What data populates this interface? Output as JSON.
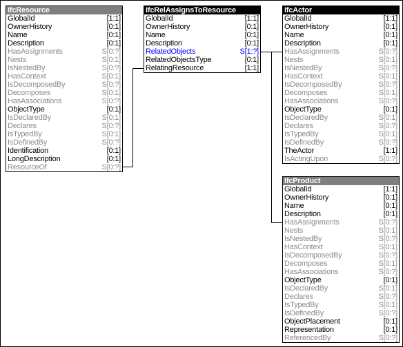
{
  "diagram": {
    "entities": [
      {
        "id": "ifc-resource",
        "name": "IfcResource",
        "header_style": "grey",
        "attributes": [
          {
            "name": "GlobalId",
            "card": "[1:1]",
            "kind": "explicit"
          },
          {
            "name": "OwnerHistory",
            "card": "[0:1]",
            "kind": "explicit"
          },
          {
            "name": "Name",
            "card": "[0:1]",
            "kind": "explicit"
          },
          {
            "name": "Description",
            "card": "[0:1]",
            "kind": "explicit"
          },
          {
            "name": "HasAssignments",
            "card": "S[0:?]",
            "kind": "inverse"
          },
          {
            "name": "Nests",
            "card": "S[0:1]",
            "kind": "inverse"
          },
          {
            "name": "IsNestedBy",
            "card": "S[0:?]",
            "kind": "inverse"
          },
          {
            "name": "HasContext",
            "card": "S[0:1]",
            "kind": "inverse"
          },
          {
            "name": "IsDecomposedBy",
            "card": "S[0:?]",
            "kind": "inverse"
          },
          {
            "name": "Decomposes",
            "card": "S[0:1]",
            "kind": "inverse"
          },
          {
            "name": "HasAssociations",
            "card": "S[0:?]",
            "kind": "inverse"
          },
          {
            "name": "ObjectType",
            "card": "[0:1]",
            "kind": "explicit"
          },
          {
            "name": "IsDeclaredBy",
            "card": "S[0:1]",
            "kind": "inverse"
          },
          {
            "name": "Declares",
            "card": "S[0:?]",
            "kind": "inverse"
          },
          {
            "name": "IsTypedBy",
            "card": "S[0:1]",
            "kind": "inverse"
          },
          {
            "name": "IsDefinedBy",
            "card": "S[0:?]",
            "kind": "inverse"
          },
          {
            "name": "Identification",
            "card": "[0:1]",
            "kind": "explicit"
          },
          {
            "name": "LongDescription",
            "card": "[0:1]",
            "kind": "explicit"
          },
          {
            "name": "ResourceOf",
            "card": "S[0:?]",
            "kind": "inverse"
          }
        ]
      },
      {
        "id": "ifc-rel-assigns-to-resource",
        "name": "IfcRelAssignsToResource",
        "header_style": "black",
        "attributes": [
          {
            "name": "GlobalId",
            "card": "[1:1]",
            "kind": "explicit"
          },
          {
            "name": "OwnerHistory",
            "card": "[0:1]",
            "kind": "explicit"
          },
          {
            "name": "Name",
            "card": "[0:1]",
            "kind": "explicit"
          },
          {
            "name": "Description",
            "card": "[0:1]",
            "kind": "explicit"
          },
          {
            "name": "RelatedObjects",
            "card": "S[1:?]",
            "kind": "highlight"
          },
          {
            "name": "RelatedObjectsType",
            "card": "[0:1]",
            "kind": "explicit"
          },
          {
            "name": "RelatingResource",
            "card": "[1:1]",
            "kind": "explicit"
          }
        ]
      },
      {
        "id": "ifc-actor",
        "name": "IfcActor",
        "header_style": "black",
        "attributes": [
          {
            "name": "GlobalId",
            "card": "[1:1]",
            "kind": "explicit"
          },
          {
            "name": "OwnerHistory",
            "card": "[0:1]",
            "kind": "explicit"
          },
          {
            "name": "Name",
            "card": "[0:1]",
            "kind": "explicit"
          },
          {
            "name": "Description",
            "card": "[0:1]",
            "kind": "explicit"
          },
          {
            "name": "HasAssignments",
            "card": "S[0:?]",
            "kind": "inverse"
          },
          {
            "name": "Nests",
            "card": "S[0:1]",
            "kind": "inverse"
          },
          {
            "name": "IsNestedBy",
            "card": "S[0:?]",
            "kind": "inverse"
          },
          {
            "name": "HasContext",
            "card": "S[0:1]",
            "kind": "inverse"
          },
          {
            "name": "IsDecomposedBy",
            "card": "S[0:?]",
            "kind": "inverse"
          },
          {
            "name": "Decomposes",
            "card": "S[0:1]",
            "kind": "inverse"
          },
          {
            "name": "HasAssociations",
            "card": "S[0:?]",
            "kind": "inverse"
          },
          {
            "name": "ObjectType",
            "card": "[0:1]",
            "kind": "explicit"
          },
          {
            "name": "IsDeclaredBy",
            "card": "S[0:1]",
            "kind": "inverse"
          },
          {
            "name": "Declares",
            "card": "S[0:?]",
            "kind": "inverse"
          },
          {
            "name": "IsTypedBy",
            "card": "S[0:1]",
            "kind": "inverse"
          },
          {
            "name": "IsDefinedBy",
            "card": "S[0:?]",
            "kind": "inverse"
          },
          {
            "name": "TheActor",
            "card": "[1:1]",
            "kind": "explicit"
          },
          {
            "name": "IsActingUpon",
            "card": "S[0:?]",
            "kind": "inverse"
          }
        ]
      },
      {
        "id": "ifc-product",
        "name": "IfcProduct",
        "header_style": "grey",
        "attributes": [
          {
            "name": "GlobalId",
            "card": "[1:1]",
            "kind": "explicit"
          },
          {
            "name": "OwnerHistory",
            "card": "[0:1]",
            "kind": "explicit"
          },
          {
            "name": "Name",
            "card": "[0:1]",
            "kind": "explicit"
          },
          {
            "name": "Description",
            "card": "[0:1]",
            "kind": "explicit"
          },
          {
            "name": "HasAssignments",
            "card": "S[0:?]",
            "kind": "inverse"
          },
          {
            "name": "Nests",
            "card": "S[0:1]",
            "kind": "inverse"
          },
          {
            "name": "IsNestedBy",
            "card": "S[0:?]",
            "kind": "inverse"
          },
          {
            "name": "HasContext",
            "card": "S[0:1]",
            "kind": "inverse"
          },
          {
            "name": "IsDecomposedBy",
            "card": "S[0:?]",
            "kind": "inverse"
          },
          {
            "name": "Decomposes",
            "card": "S[0:1]",
            "kind": "inverse"
          },
          {
            "name": "HasAssociations",
            "card": "S[0:?]",
            "kind": "inverse"
          },
          {
            "name": "ObjectType",
            "card": "[0:1]",
            "kind": "explicit"
          },
          {
            "name": "IsDeclaredBy",
            "card": "S[0:1]",
            "kind": "inverse"
          },
          {
            "name": "Declares",
            "card": "S[0:?]",
            "kind": "inverse"
          },
          {
            "name": "IsTypedBy",
            "card": "S[0:1]",
            "kind": "inverse"
          },
          {
            "name": "IsDefinedBy",
            "card": "S[0:?]",
            "kind": "inverse"
          },
          {
            "name": "ObjectPlacement",
            "card": "[0:1]",
            "kind": "explicit"
          },
          {
            "name": "Representation",
            "card": "[0:1]",
            "kind": "explicit"
          },
          {
            "name": "ReferencedBy",
            "card": "S[0:?]",
            "kind": "inverse"
          }
        ]
      }
    ],
    "relations": [
      {
        "from": "IfcResource.ResourceOf",
        "to": "IfcRelAssignsToResource.RelatingResource"
      },
      {
        "from": "IfcRelAssignsToResource.RelatedObjects",
        "to": "IfcActor.HasAssignments"
      },
      {
        "from": "IfcRelAssignsToResource.RelatedObjects",
        "to": "IfcProduct.HasAssignments"
      }
    ],
    "colors": {
      "explicit_text": "#000000",
      "inverse_text": "#8c8c8c",
      "highlight_text": "#0000ff",
      "header_grey": "#7f7f7f",
      "header_black": "#000000"
    }
  }
}
